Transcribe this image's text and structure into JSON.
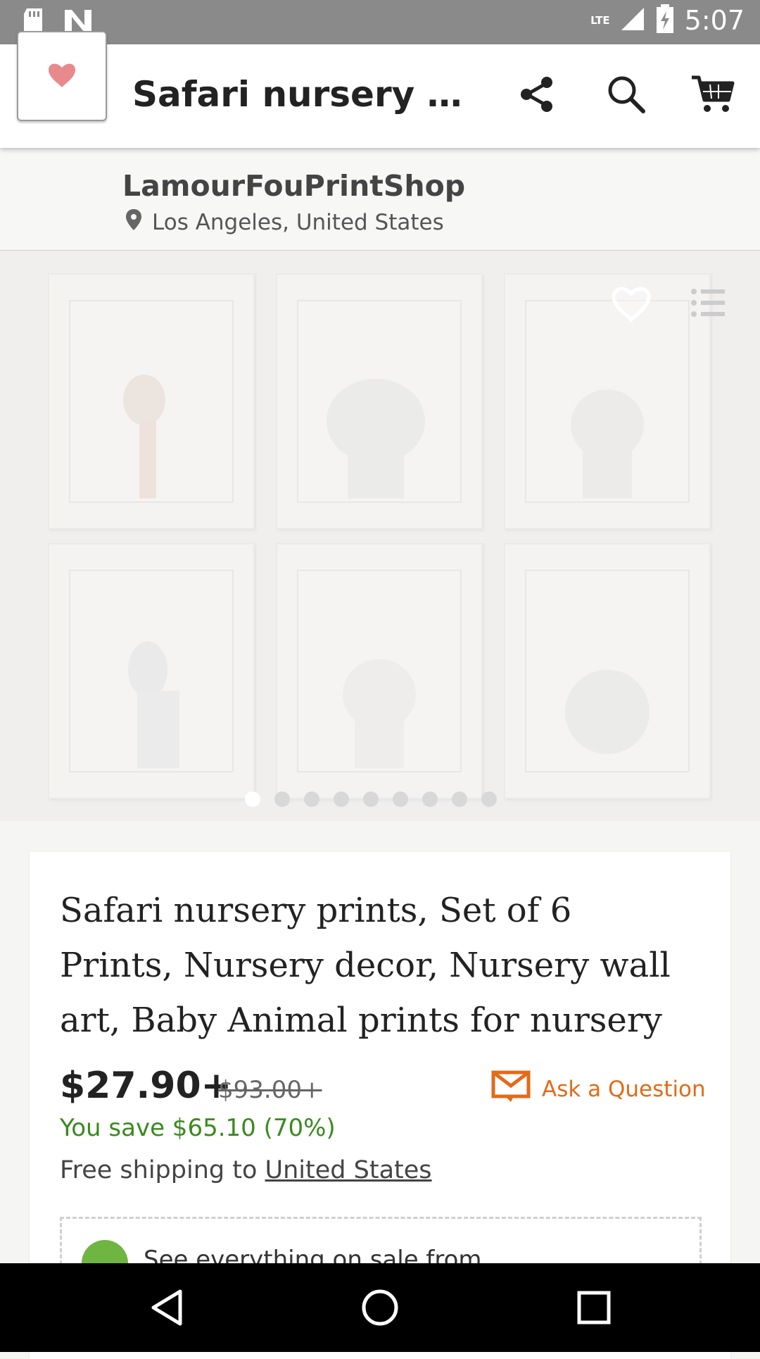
{
  "status_bar": {
    "time": "5:07",
    "network": "LTE",
    "icons": [
      "sd-card-icon",
      "n-notification-icon",
      "signal-icon",
      "battery-charging-icon"
    ]
  },
  "app_bar": {
    "title": "Safari nursery pri...",
    "icons": [
      "hamburger-menu-icon",
      "share-icon",
      "search-icon",
      "cart-icon"
    ]
  },
  "shop": {
    "name": "LamourFouPrintShop",
    "location": "Los Angeles, United States"
  },
  "gallery": {
    "image_count": 9,
    "active_index": 0,
    "icons": [
      "favorite-heart-icon",
      "add-to-list-icon"
    ]
  },
  "listing": {
    "title": "Safari nursery prints, Set of 6 Prints, Nursery decor, Nursery wall art, Baby Animal prints for nursery",
    "price": "$27.90+",
    "original_price": "$93.00+",
    "savings": "You save $65.10 (70%)",
    "ask_label": "Ask a Question",
    "shipping_prefix": "Free shipping to",
    "shipping_country": "United States",
    "sale_text": "See everything on sale from"
  },
  "colors": {
    "accent": "#e26b19",
    "savings_green": "#3a8a1f",
    "sale_badge": "#6fb541"
  },
  "nav_bar": {
    "icons": [
      "back-icon",
      "home-icon",
      "recents-icon"
    ]
  }
}
